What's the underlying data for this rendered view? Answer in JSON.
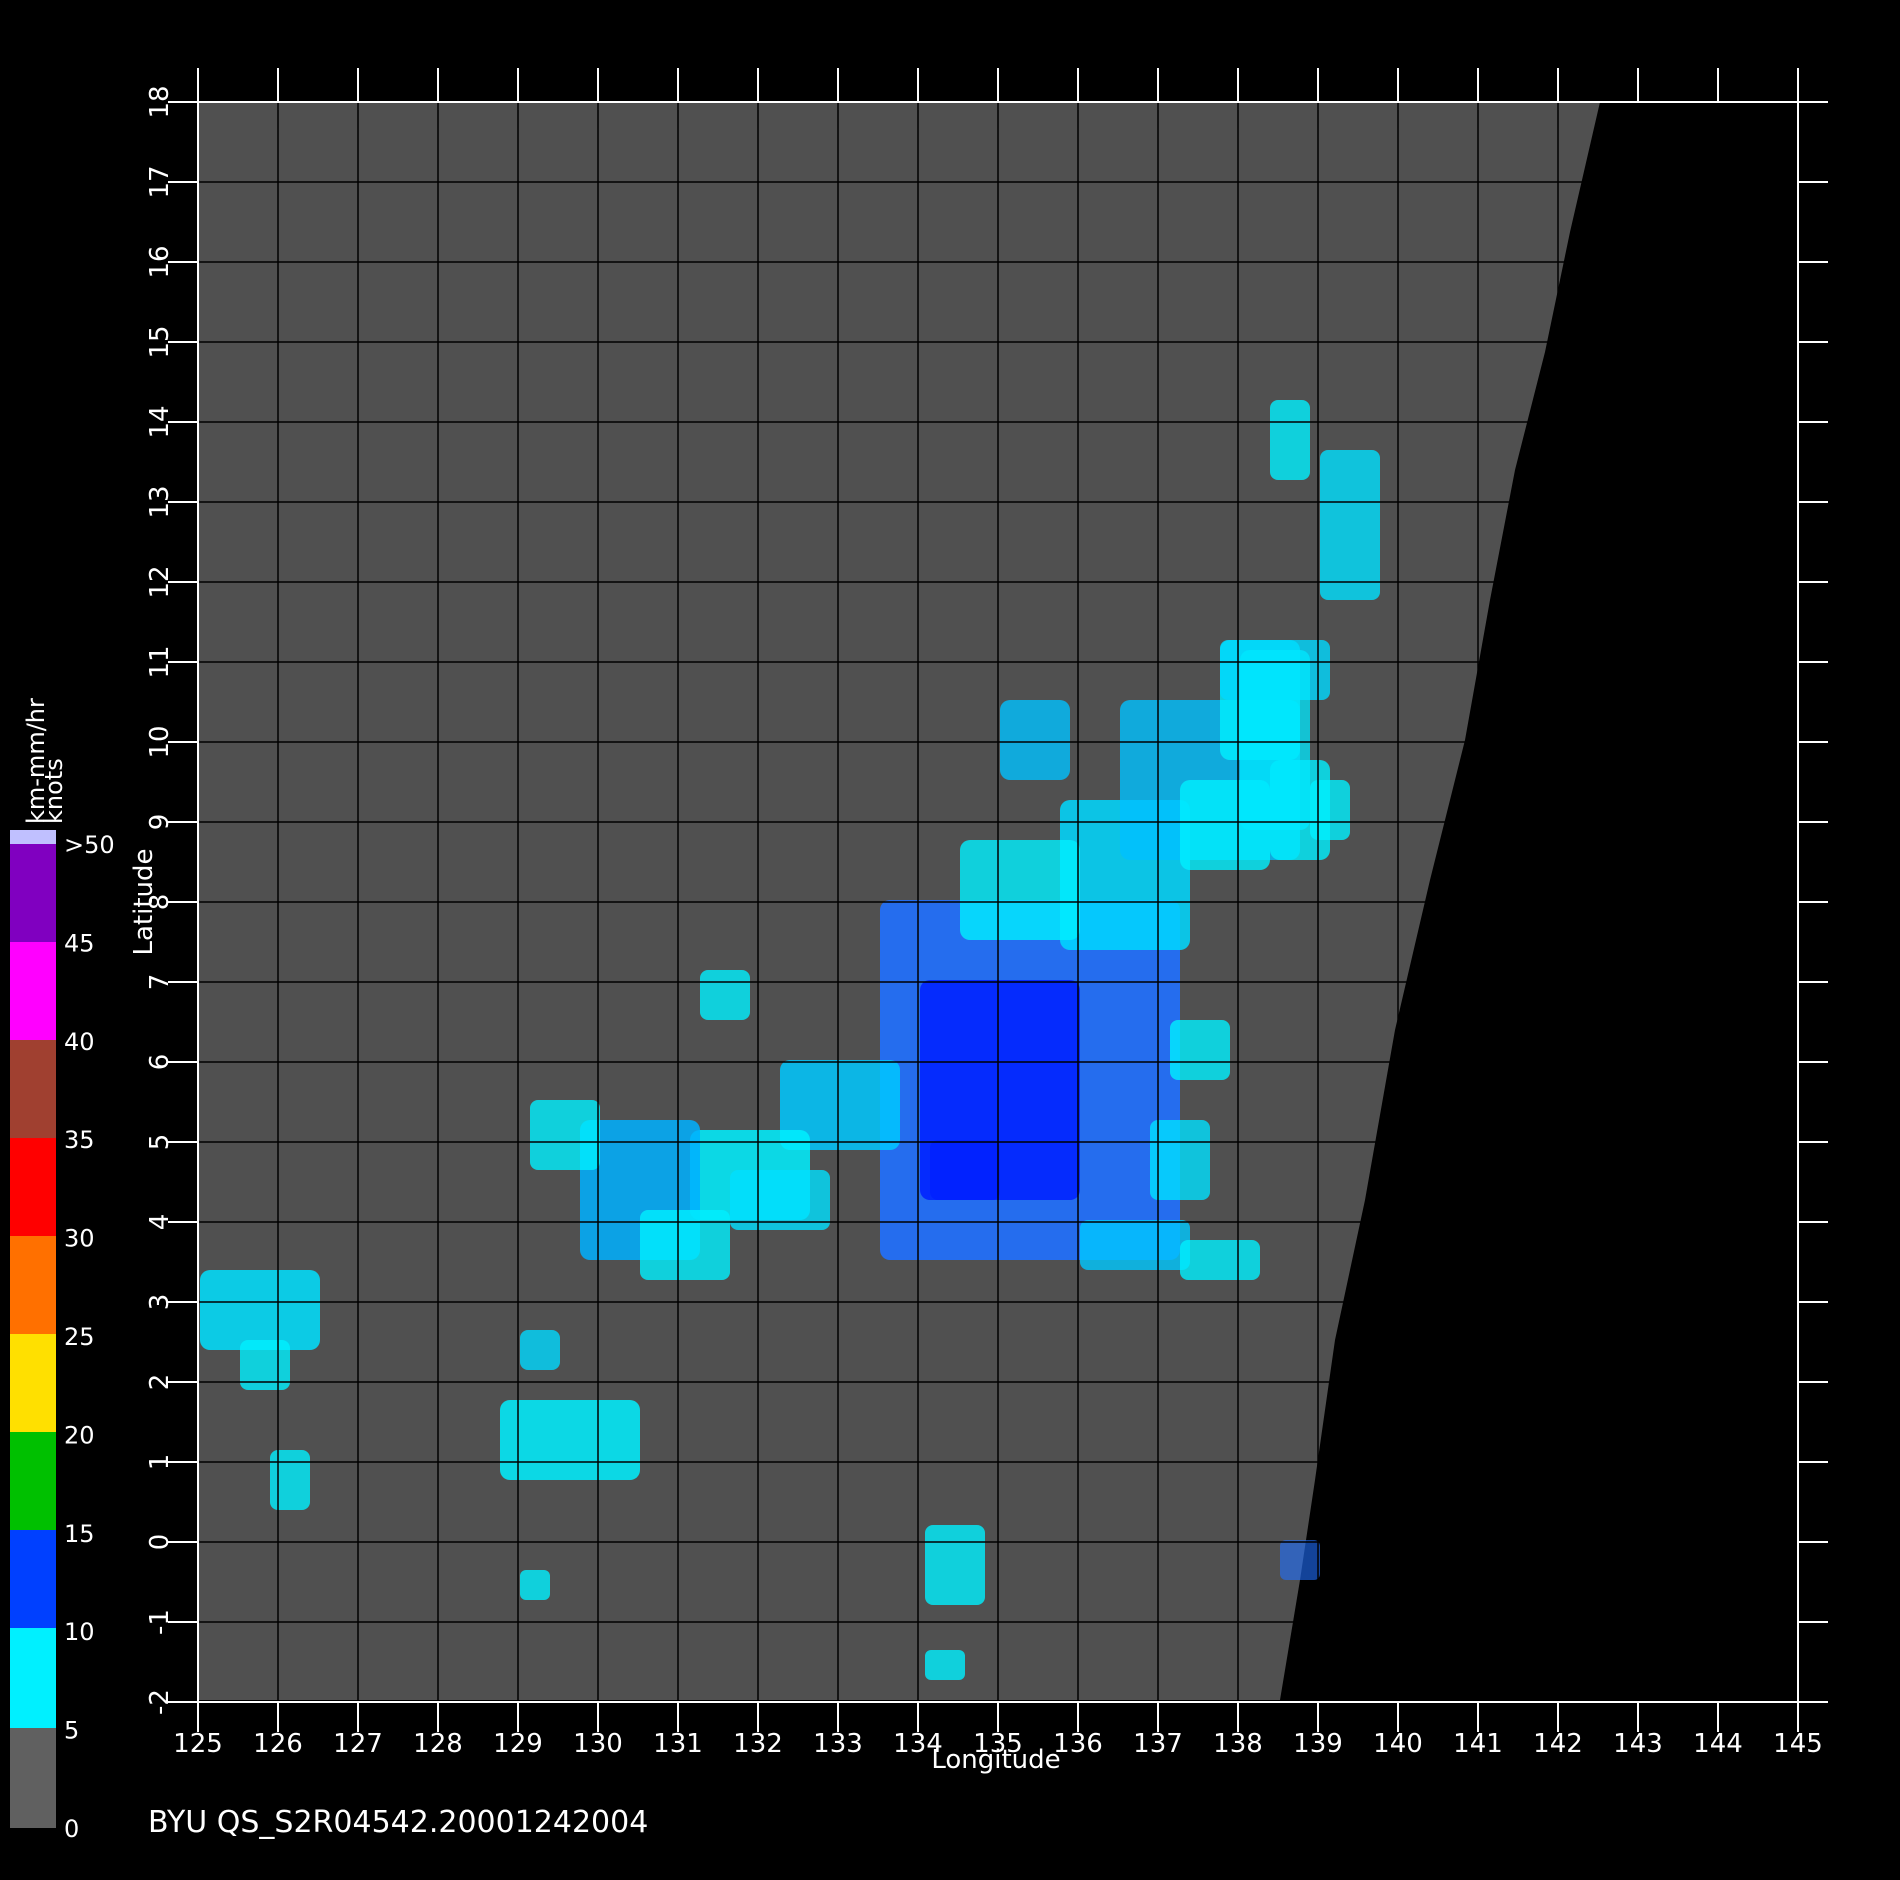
{
  "chart_data": {
    "type": "scatter",
    "xlabel": "Longitude",
    "ylabel": "Latitude",
    "xlim": [
      125,
      145
    ],
    "ylim": [
      -2,
      18
    ],
    "x_ticks": [
      "125",
      "126",
      "127",
      "128",
      "129",
      "130",
      "131",
      "132",
      "133",
      "134",
      "135",
      "136",
      "137",
      "138",
      "139",
      "140",
      "141",
      "142",
      "143",
      "144",
      "145"
    ],
    "y_ticks": [
      "-2",
      "-1",
      "0",
      "1",
      "2",
      "3",
      "4",
      "5",
      "6",
      "7",
      "8",
      "9",
      "10",
      "11",
      "12",
      "13",
      "14",
      "15",
      "16",
      "17",
      "18"
    ],
    "grid": true,
    "footer": "BYU  QS_S2R04542.20001242004",
    "colorbar": {
      "unit_line_1": "km-mm/hr",
      "unit_line_2": "knots",
      "labels": [
        "0",
        "5",
        "10",
        "15",
        "20",
        "25",
        "30",
        "35",
        "40",
        "45",
        ">50"
      ],
      "colors": {
        "gray": "#606060",
        "cyan": "#00f0ff",
        "blue": "#0020ff",
        "green": "#00b000",
        "yellow": "#ffe000",
        "orange": "#ff6000",
        "red": "#ff0000",
        "brown": "#a05030",
        "magenta": "#ff00ff",
        "purple": "#8000c0"
      }
    },
    "colors": {
      "background": "#000000",
      "swath": "#505050",
      "grid": "#000000",
      "axis": "#ffffff"
    }
  }
}
